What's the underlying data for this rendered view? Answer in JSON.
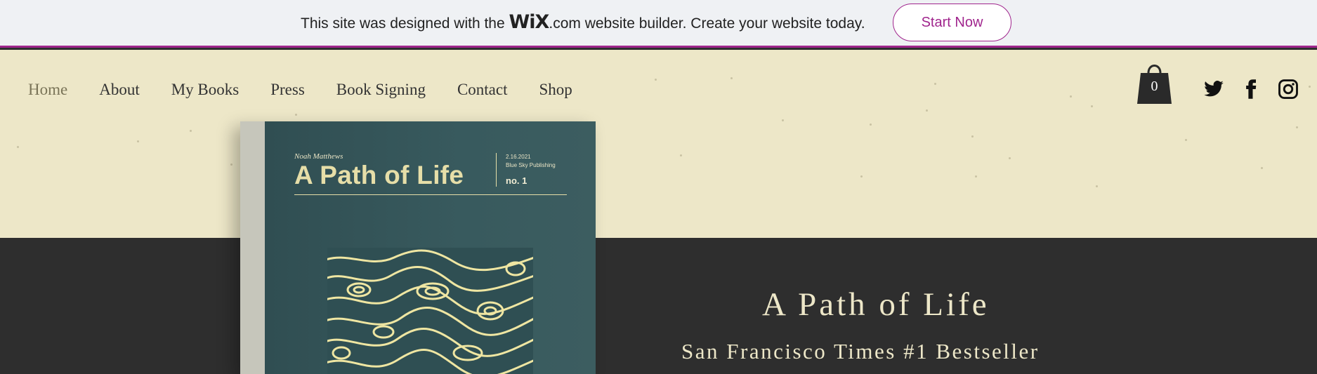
{
  "banner": {
    "text_before": "This site was designed with the",
    "logo": "WiX",
    "text_after": ".com website builder. Create your website today.",
    "cta_label": "Start Now"
  },
  "nav": {
    "items": [
      {
        "label": "Home",
        "active": true
      },
      {
        "label": "About"
      },
      {
        "label": "My Books"
      },
      {
        "label": "Press"
      },
      {
        "label": "Book Signing"
      },
      {
        "label": "Contact"
      },
      {
        "label": "Shop"
      }
    ]
  },
  "cart": {
    "count": "0",
    "icon": "shopping-bag-icon"
  },
  "social": [
    {
      "name": "Twitter",
      "icon": "twitter-icon"
    },
    {
      "name": "Facebook",
      "icon": "facebook-icon"
    },
    {
      "name": "Instagram",
      "icon": "instagram-icon"
    }
  ],
  "book_cover": {
    "author": "Noah Matthews",
    "title": "A Path of Life",
    "date": "2.16.2021",
    "publisher": "Blue Sky Publishing",
    "number": "no. 1"
  },
  "hero": {
    "title": "A Path of Life",
    "subtitle": "San Francisco Times #1 Bestseller"
  },
  "colors": {
    "brand_accent": "#a0258d",
    "header_bg": "#ede7c8",
    "hero_bg": "#2e2e2e",
    "cover_bg": "#385a5e",
    "cover_text": "#e6dea8"
  }
}
